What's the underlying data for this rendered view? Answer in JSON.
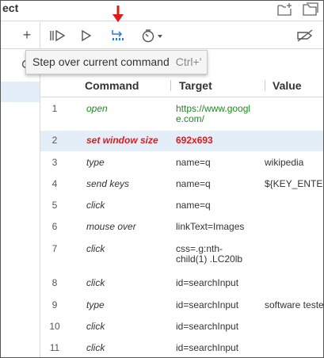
{
  "window": {
    "title": "ect"
  },
  "toolbar": {
    "tooltip_text": "Step over current command",
    "tooltip_shortcut": "Ctrl+'"
  },
  "sidebar": {
    "add_label": "+"
  },
  "table": {
    "headers": [
      "Command",
      "Target",
      "Value"
    ],
    "rows": [
      {
        "num": "1",
        "command": "open",
        "target": "https://www.google.com/",
        "value": ""
      },
      {
        "num": "2",
        "command": "set window size",
        "target": "692x693",
        "value": ""
      },
      {
        "num": "3",
        "command": "type",
        "target": "name=q",
        "value": "wikipedia"
      },
      {
        "num": "4",
        "command": "send keys",
        "target": "name=q",
        "value": "${KEY_ENTER}"
      },
      {
        "num": "5",
        "command": "click",
        "target": "name=q",
        "value": ""
      },
      {
        "num": "6",
        "command": "mouse over",
        "target": "linkText=Images",
        "value": ""
      },
      {
        "num": "7",
        "command": "click",
        "target": "css=.g:nth-child(1) .LC20lb",
        "value": ""
      },
      {
        "num": "8",
        "command": "click",
        "target": "id=searchInput",
        "value": ""
      },
      {
        "num": "9",
        "command": "type",
        "target": "id=searchInput",
        "value": "software testers"
      },
      {
        "num": "10",
        "command": "click",
        "target": "id=searchInput",
        "value": ""
      },
      {
        "num": "11",
        "command": "click",
        "target": "id=searchInput",
        "value": ""
      }
    ]
  },
  "colors": {
    "open_command": "#1f8a1f",
    "current_command": "#e01a1a",
    "selected_row": "#e3eef8",
    "annotation_arrow": "#e01a1a",
    "step_icon": "#2b7bd0"
  }
}
